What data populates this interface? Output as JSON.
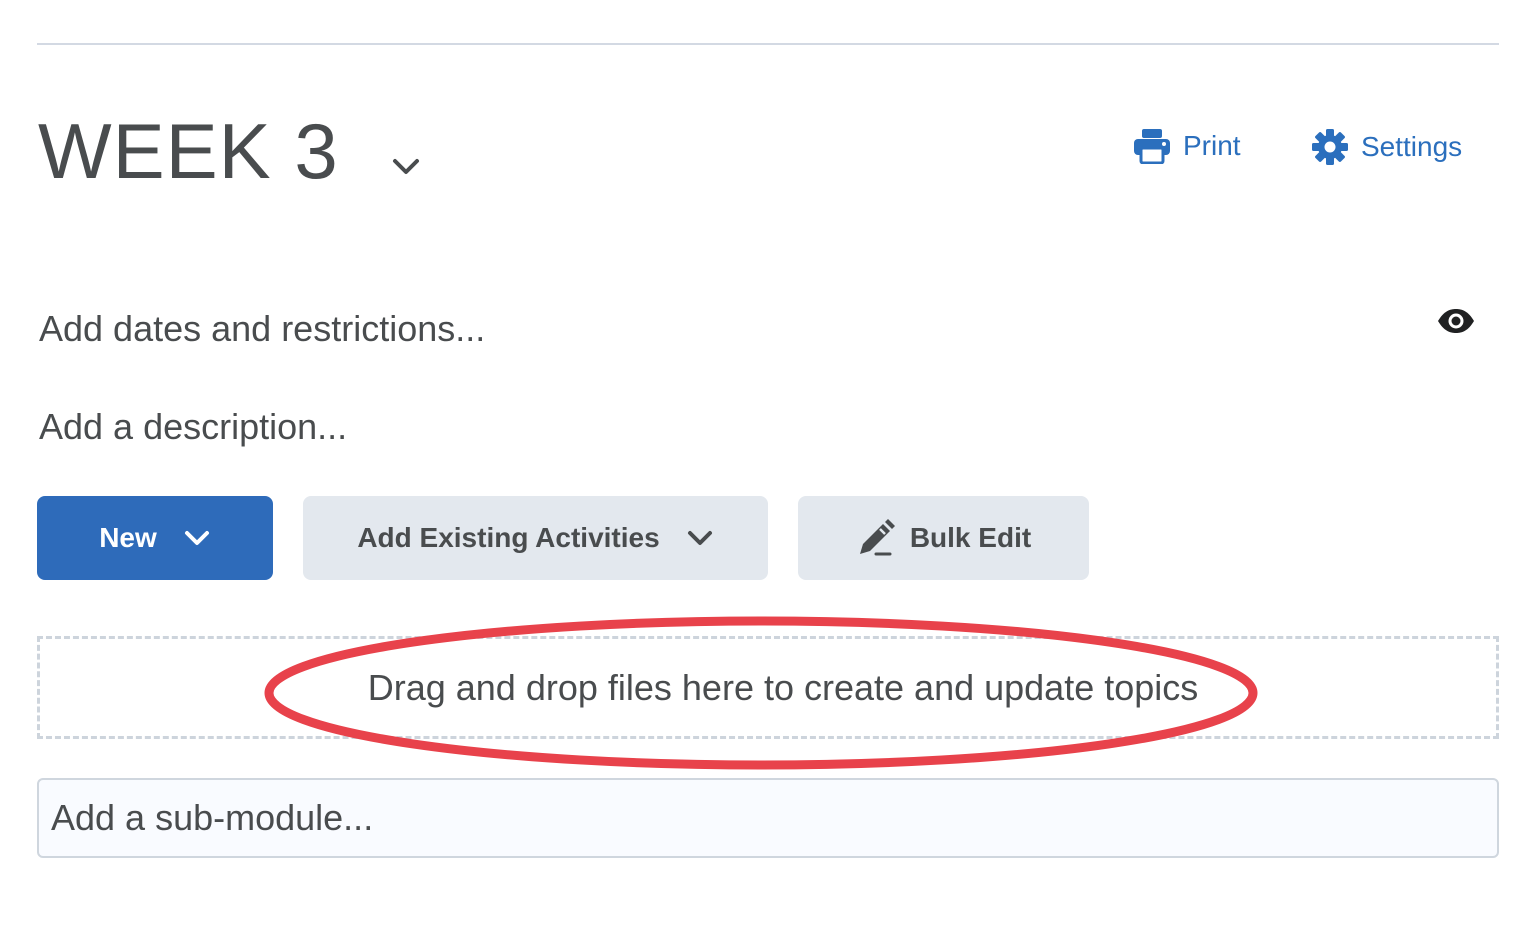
{
  "module": {
    "title": "WEEK 3"
  },
  "actions": {
    "print_label": "Print",
    "settings_label": "Settings"
  },
  "fields": {
    "dates_restrictions": "Add dates and restrictions...",
    "description": "Add a description..."
  },
  "buttons": {
    "new_label": "New",
    "add_existing_label": "Add Existing Activities",
    "bulk_edit_label": "Bulk Edit"
  },
  "dropzone": {
    "text": "Drag and drop files here to create and update topics"
  },
  "submodule": {
    "placeholder": "Add a sub-module..."
  },
  "icons": {
    "title_chevron": "chevron-down-icon",
    "print": "printer-icon",
    "settings": "gear-icon",
    "visibility": "eye-icon",
    "new_chevron": "chevron-down-icon",
    "existing_chevron": "chevron-down-icon",
    "bulk_edit": "pencil-icon"
  },
  "colors": {
    "primary": "#2e6bba",
    "link": "#2b6fbd",
    "secondary_button": "#e3e8ee",
    "text": "#494c4e",
    "annotation": "#e8424b"
  }
}
